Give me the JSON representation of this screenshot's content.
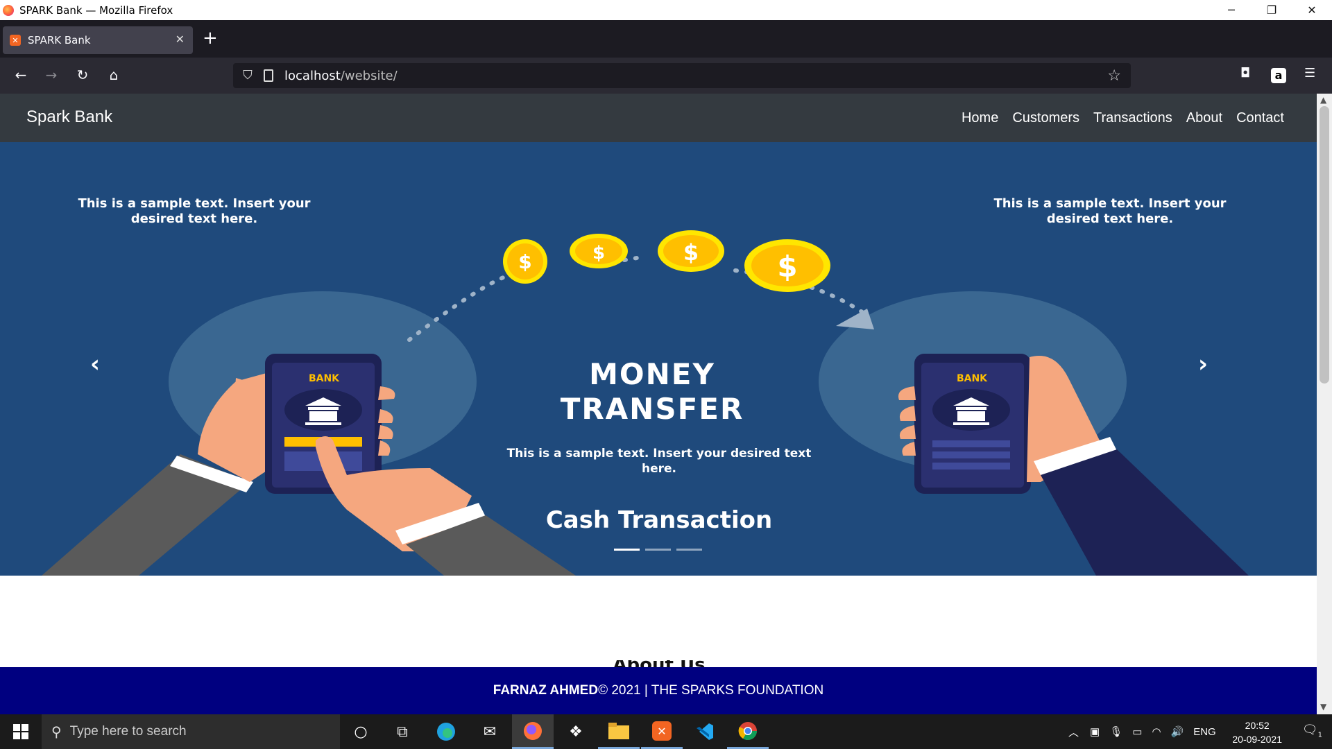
{
  "window": {
    "title": "SPARK Bank — Mozilla Firefox",
    "minimize": "─",
    "restore": "❐",
    "close": "✕"
  },
  "browser": {
    "tab_title": "SPARK Bank",
    "tab_close": "✕",
    "new_tab": "+",
    "url_host": "localhost",
    "url_path": "/website/",
    "back": "←",
    "forward": "→",
    "reload": "↻",
    "home": "⌂",
    "bookmark": "☆",
    "pocket": "◘",
    "amazon": "a",
    "menu": "☰"
  },
  "site": {
    "brand": "Spark Bank",
    "nav": [
      "Home",
      "Customers",
      "Transactions",
      "About",
      "Contact"
    ],
    "hero": {
      "left_text": "This is a sample text. Insert your desired text here.",
      "right_text": "This is a sample text. Insert your desired text here.",
      "title_line1": "MONEY",
      "title_line2": "TRANSFER",
      "subtitle": "This is a sample text. Insert your desired text here.",
      "caption": "Cash Transaction",
      "phone_label_left": "BANK",
      "phone_label_right": "BANK",
      "coin_symbol": "$",
      "prev": "‹",
      "next": "›",
      "slides": 3,
      "active_slide": 1
    },
    "about_peek": "About Us",
    "footer": {
      "author": "FARNAZ AHMED",
      "rest": " © 2021 | THE SPARKS FOUNDATION"
    }
  },
  "taskbar": {
    "search_placeholder": "Type here to search",
    "lang": "ENG",
    "time": "20:52",
    "date": "20-09-2021",
    "notif_count": "1"
  },
  "colors": {
    "site_nav": "#343a40",
    "hero_bg": "#1f4a7c",
    "footer_bg": "#000080",
    "coin": "#ffd600"
  }
}
